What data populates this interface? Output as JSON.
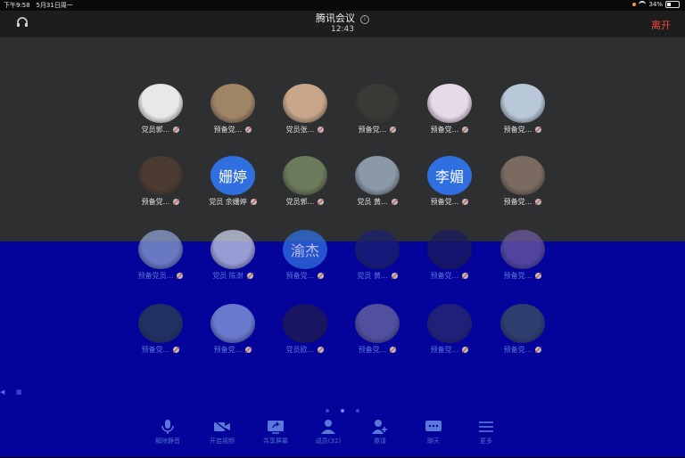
{
  "status": {
    "time": "下午9:58",
    "date": "5月31日周一",
    "battery": "34%"
  },
  "header": {
    "title": "腾讯会议",
    "timer": "12:43",
    "leave_label": "离开"
  },
  "colors": {
    "accent_blue": "#2f6fe0",
    "leave_red": "#f5473a",
    "panel_bg": "#2e2f30"
  },
  "participants_top": [
    {
      "name": "党员郭...",
      "avatar": "cartoon-aviator",
      "color": "#e8e8e8"
    },
    {
      "name": "预备党...",
      "avatar": "baby-photo",
      "color": "#a08466"
    },
    {
      "name": "党员张...",
      "avatar": "selfie-photo",
      "color": "#c9a689"
    },
    {
      "name": "预备党...",
      "avatar": "person-photo",
      "color": "#3b3936"
    },
    {
      "name": "预备党...",
      "avatar": "anime-boy",
      "color": "#e6d9e8"
    },
    {
      "name": "预备党...",
      "avatar": "anime-white-hair",
      "color": "#b8c8d8"
    },
    {
      "name": "预备党...",
      "avatar": "man-photo",
      "color": "#4a3a32"
    },
    {
      "name": "党员 余姗婷",
      "avatar_text": "姗婷"
    },
    {
      "name": "党员郭...",
      "avatar": "man-outdoor",
      "color": "#6b7a5a"
    },
    {
      "name": "党员 黄...",
      "avatar": "airplane-sky",
      "color": "#8a98a8"
    },
    {
      "name": "预备党...",
      "avatar_text": "李媚"
    },
    {
      "name": "预备党...",
      "avatar": "cats-photo",
      "color": "#7a6a60"
    }
  ],
  "participants_bottom": [
    {
      "name": "预备党员...",
      "avatar": "landscape",
      "color": "#8aa0d0"
    },
    {
      "name": "党员 陈澍",
      "avatar": "sketch",
      "color": "#c8d0e8"
    },
    {
      "name": "预备党...",
      "avatar_text": "渝杰"
    },
    {
      "name": "党员 黄...",
      "avatar": "dark-photo",
      "color": "#1a2070"
    },
    {
      "name": "预备党...",
      "avatar": "night-photo",
      "color": "#1a1a60"
    },
    {
      "name": "预备党...",
      "avatar": "child-photo",
      "color": "#6a5aa0"
    },
    {
      "name": "预备党...",
      "avatar": "plant-photo",
      "color": "#2a4050"
    },
    {
      "name": "预备党...",
      "avatar": "girl-photo",
      "color": "#8aa0e0"
    },
    {
      "name": "党员欧...",
      "avatar": "dark-girl",
      "color": "#201a50"
    },
    {
      "name": "预备党...",
      "avatar": "group-photo",
      "color": "#6a6aa0"
    },
    {
      "name": "预备党...",
      "avatar": "man-dark",
      "color": "#2a2a70"
    },
    {
      "name": "预备党...",
      "avatar": "forest-photo",
      "color": "#3a5060"
    }
  ],
  "toolbar": [
    {
      "label": "解除静音",
      "icon": "mic-icon"
    },
    {
      "label": "开启视频",
      "icon": "video-icon"
    },
    {
      "label": "共享屏幕",
      "icon": "share-screen-icon"
    },
    {
      "label": "成员(32)",
      "icon": "members-icon"
    },
    {
      "label": "邀请",
      "icon": "invite-icon"
    },
    {
      "label": "聊天",
      "icon": "chat-icon"
    },
    {
      "label": "更多",
      "icon": "more-icon"
    }
  ]
}
